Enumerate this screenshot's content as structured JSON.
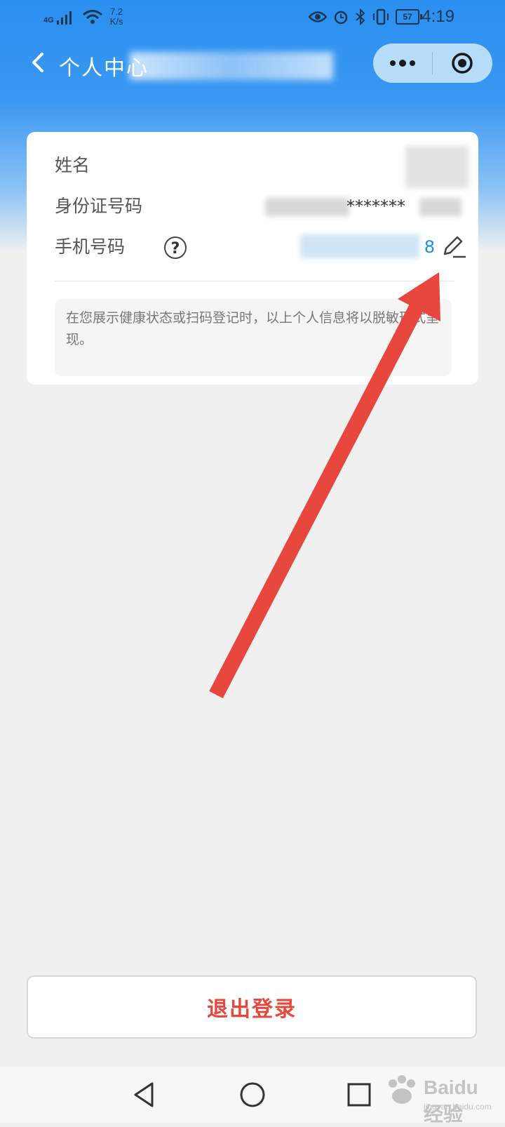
{
  "status_bar": {
    "network": "4G",
    "speed_value": "7.2",
    "speed_unit": "K/s",
    "battery": "57",
    "time": "4:19"
  },
  "nav": {
    "title": "个人中心",
    "back_icon": "chevron-left-icon",
    "more_icon": "more-dots-icon",
    "close_icon": "target-circle-icon",
    "capsule_color": "#b6dcfa"
  },
  "card": {
    "rows": [
      {
        "label": "姓名",
        "value": ""
      },
      {
        "label": "身份证号码",
        "value": "*******"
      },
      {
        "label": "手机号码",
        "value": "8",
        "help_icon": "question-circle-icon",
        "edit_icon": "pencil-edit-icon"
      }
    ],
    "help_symbol": "?",
    "notice": "在您展示健康状态或扫码登记时，以上个人信息将以脱敏形式呈现。"
  },
  "logout": {
    "label": "退出登录",
    "color": "#e8473e"
  },
  "system_nav": {
    "back_icon": "triangle-back-icon",
    "home_icon": "circle-home-icon",
    "recents_icon": "square-recents-icon"
  },
  "watermark": {
    "brand": "Baidu 经验",
    "url": "jingyan.baidu.com"
  },
  "colors": {
    "header_blue": "#2a8ff0",
    "arrow_red": "#e8473e",
    "phone_blue": "#1f8fde"
  }
}
